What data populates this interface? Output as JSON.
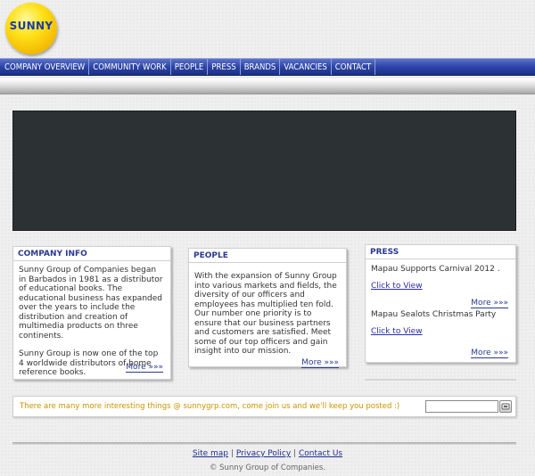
{
  "logo": {
    "text": "SUNNY"
  },
  "nav": {
    "items": [
      {
        "label": "COMPANY OVERVIEW"
      },
      {
        "label": "COMMUNITY WORK"
      },
      {
        "label": "PEOPLE"
      },
      {
        "label": "PRESS"
      },
      {
        "label": "BRANDS"
      },
      {
        "label": "VACANCIES"
      },
      {
        "label": "CONTACT"
      }
    ]
  },
  "company_info": {
    "title": "COMPANY INFO",
    "para1": "Sunny Group of Companies began in Barbados in 1981 as a distributor of educational books. The educational business has expanded over the years to include the distribution and creation of multimedia products on three continents.",
    "para2": "Sunny Group is now one of the top 4 worldwide distributors of home reference books.",
    "more": "More »»»"
  },
  "people": {
    "title": "PEOPLE",
    "body": "With the expansion of Sunny Group into various markets and fields, the diversity of our officers and employees has multiplied ten fold. Our number one priority is to ensure that our business partners and customers are satisfied. Meet some of our top officers and gain insight into our mission.",
    "more": "More »»»"
  },
  "press": {
    "title": "PRESS",
    "items": [
      {
        "headline": "Mapau Supports Carnival 2012 .",
        "link": "Click to View",
        "more": "More »»»"
      },
      {
        "headline": "Mapau Sealots Christmas Party",
        "link": "Click to View",
        "more": "More »»»"
      }
    ]
  },
  "strip": {
    "message": "There are many more interesting things @ sunnygrp.com, come join us and we'll keep you posted :)",
    "search_value": ""
  },
  "footer": {
    "links": [
      {
        "label": "Site map"
      },
      {
        "label": "Privacy Policy"
      },
      {
        "label": "Contact Us"
      }
    ],
    "separator": "|",
    "copyright": "© Sunny Group of Companies."
  }
}
